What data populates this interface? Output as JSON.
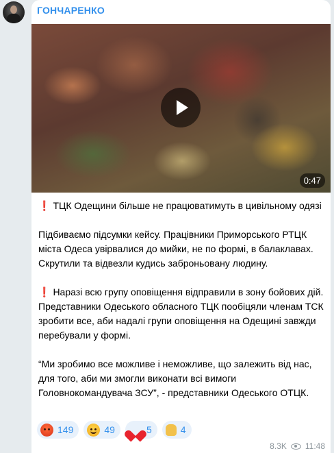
{
  "channel": {
    "name": "ГОНЧАРЕНКО"
  },
  "video": {
    "duration": "0:47"
  },
  "message": {
    "headline": "ТЦК Одещини більше не працюватимуть в цивільному одязі",
    "paragraph1": "Підбиваємо підсумки кейсу. Працівники Приморського РТЦК міста Одеса увірвалися до мийки, не по формі, в балаклавах. Скрутили та відвезли кудись заброньовану людину.",
    "paragraph2": "Наразі всю групу оповіщення відправили в зону бойових дій. Представники Одеського обласного ТЦК пообіцяли членам ТСК зробити все, аби надалі групи оповіщення на Одещині завжди перебували у формі.",
    "paragraph3": "“Ми зробимо все можливе і неможливе, що залежить від нас, для того, аби ми змогли виконати всі вимоги Головнокомандувача ЗСУ”, - представники Одеського ОТЦК.",
    "exclamation": "❗"
  },
  "reactions": [
    {
      "icon": "angry-face-icon",
      "count": "149"
    },
    {
      "icon": "grinning-face-icon",
      "count": "49"
    },
    {
      "icon": "red-heart-icon",
      "count": "5"
    },
    {
      "icon": "thumbs-up-icon",
      "count": "4"
    }
  ],
  "meta": {
    "views": "8.3K",
    "time": "11:48"
  },
  "colors": {
    "accent": "#3390ec",
    "background": "#e6ebee",
    "bubble": "#ffffff"
  }
}
